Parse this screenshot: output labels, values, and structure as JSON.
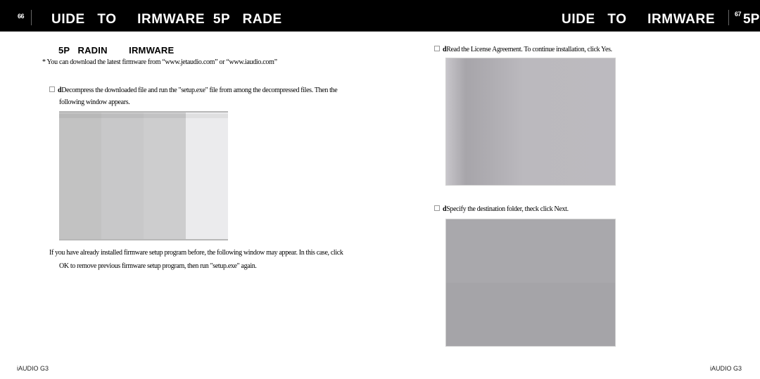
{
  "header": {
    "left_page_number": "66",
    "left_title": "UIDE   TO     IRMWARE  5P   RADE",
    "right_title": "UIDE   TO     IRMWARE",
    "right_page_number": "67",
    "right_suffix": "5P",
    "background_color": "#000000",
    "text_color": "#ffffff"
  },
  "left_page": {
    "section_heading": "5P   RADIN        IRMWARE",
    "note": "* You can download the latest firmware from “www.jetaudio.com” or “www.iaudio.com”",
    "step1": {
      "marker": "d",
      "line1": "Decompress the downloaded file and run the \"setup.exe\" file from among the decompressed files. Then the",
      "line2": "following window appears."
    },
    "screenshot1": {
      "columns": [
        "#c2c2c2",
        "#c8c8c9",
        "#cdcdce",
        "#ebebed"
      ]
    },
    "paragraph": {
      "line1": "If you have already installed firmware setup program before, the following window may appear. In this case, click",
      "line2": "OK to remove previous firmware setup program, then run \"setup.exe\" again."
    }
  },
  "right_page": {
    "step2": {
      "marker": "d",
      "text": "Read the License Agreement. To continue installation, click Yes."
    },
    "step3": {
      "marker": "d",
      "text": "Specify the destination folder, theck click Next."
    }
  },
  "footer": {
    "left": "iAUDIO G3",
    "right": "iAUDIO G3"
  }
}
